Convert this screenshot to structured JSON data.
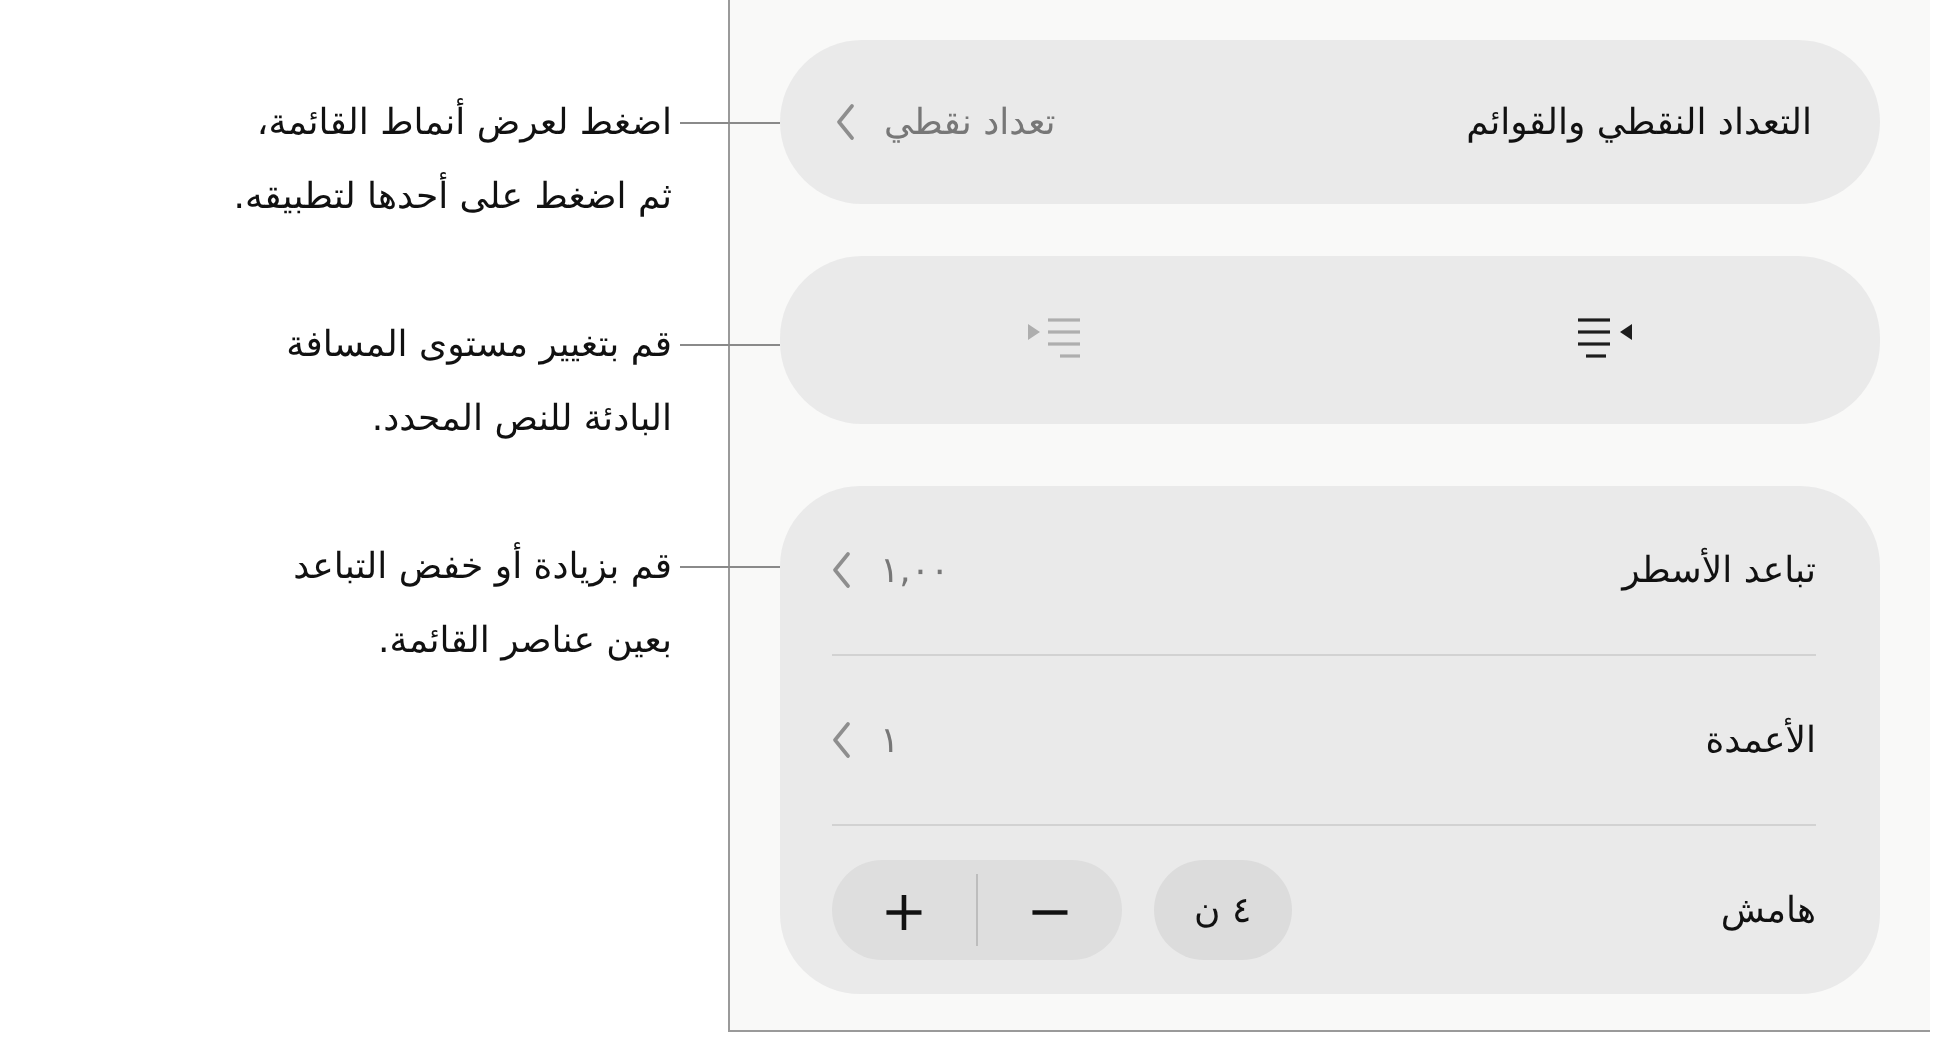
{
  "callouts": [
    {
      "lines": [
        "اضغط لعرض أنماط القائمة،",
        "ثم اضغط على أحدها لتطبيقه."
      ]
    },
    {
      "lines": [
        "قم بتغيير مستوى المسافة",
        "البادئة للنص المحدد."
      ]
    },
    {
      "lines": [
        "قم بزيادة أو خفض التباعد",
        "بعين عناصر القائمة."
      ]
    }
  ],
  "list_style": {
    "label": "التعداد النقطي والقوائم",
    "value": "تعداد نقطي"
  },
  "indent_buttons": [
    {
      "kind": "outdent",
      "disabled": false
    },
    {
      "kind": "indent",
      "disabled": true
    }
  ],
  "rows": [
    {
      "kind": "disclosure",
      "label": "تباعد الأسطر",
      "value": "١,٠٠"
    },
    {
      "kind": "disclosure",
      "label": "الأعمدة",
      "value": "١"
    },
    {
      "kind": "stepper",
      "label": "هامش",
      "value": "٤ ن",
      "decrement": "−",
      "increment": "+"
    }
  ]
}
